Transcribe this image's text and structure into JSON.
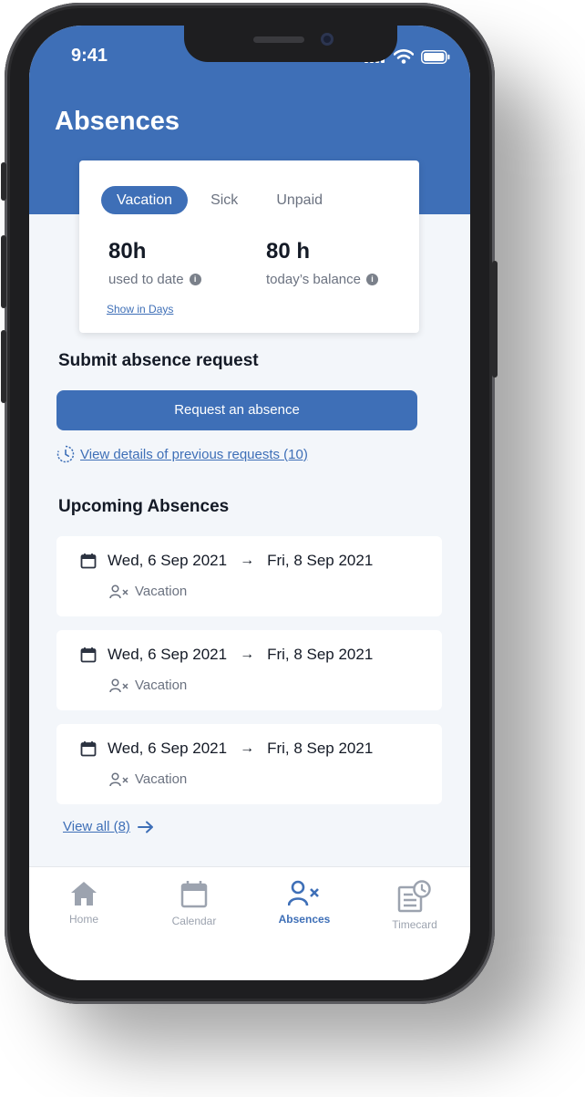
{
  "status_bar": {
    "time": "9:41"
  },
  "header": {
    "title": "Absences"
  },
  "balance_card": {
    "tabs": [
      {
        "label": "Vacation",
        "active": true
      },
      {
        "label": "Sick",
        "active": false
      },
      {
        "label": "Unpaid",
        "active": false
      }
    ],
    "used": {
      "value": "80h",
      "label": "used to date"
    },
    "balance": {
      "value": "80 h",
      "label": "today’s balance"
    },
    "info_glyph": "i",
    "show_days_link": "Show in Days"
  },
  "submit_section": {
    "title": "Submit absence request",
    "button_label": "Request an absence",
    "history_link": "View details of previous requests (10)"
  },
  "upcoming": {
    "title": "Upcoming Absences",
    "items": [
      {
        "start": "Wed, 6 Sep 2021",
        "end": "Fri, 8 Sep 2021",
        "type": "Vacation"
      },
      {
        "start": "Wed, 6 Sep 2021",
        "end": "Fri, 8 Sep 2021",
        "type": "Vacation"
      },
      {
        "start": "Wed, 6 Sep 2021",
        "end": "Fri, 8 Sep 2021",
        "type": "Vacation"
      }
    ],
    "view_all": "View all (8)"
  },
  "tabbar": {
    "items": [
      {
        "label": "Home",
        "icon": "home-icon",
        "active": false
      },
      {
        "label": "Calendar",
        "icon": "calendar-icon",
        "active": false
      },
      {
        "label": "Absences",
        "icon": "person-x-icon",
        "active": true
      },
      {
        "label": "Timecard",
        "icon": "timecard-icon",
        "active": false
      }
    ]
  },
  "colors": {
    "brand": "#3e6fb7",
    "background": "#f3f6fa",
    "text": "#141a26",
    "muted": "#6b7280"
  }
}
